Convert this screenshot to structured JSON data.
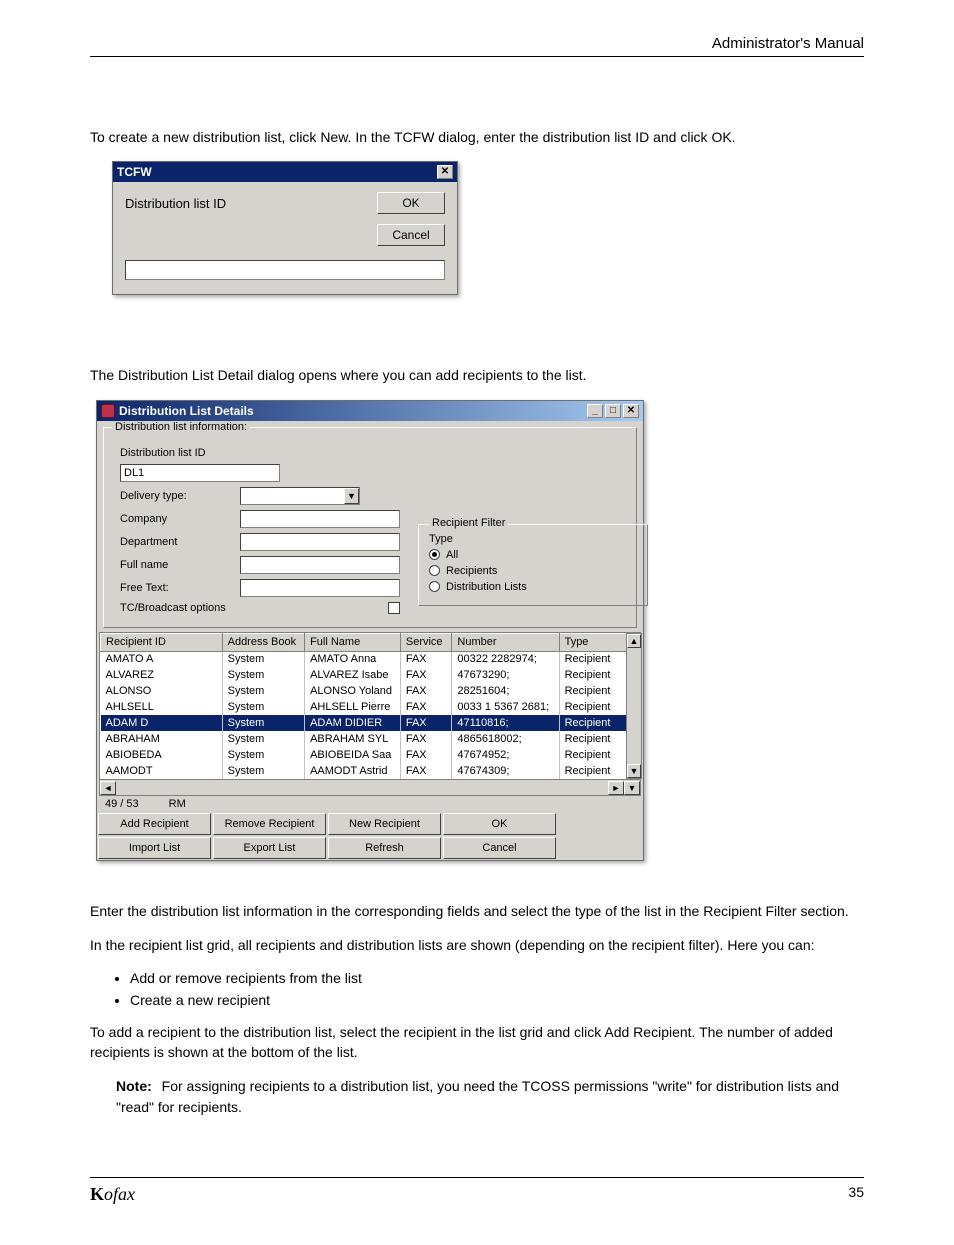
{
  "page_header": "Administrator's Manual",
  "intro_text": "To create a new distribution list, click New. In the TCFW dialog, enter the distribution list ID and click OK.",
  "tcfw": {
    "title": "TCFW",
    "label": "Distribution list ID",
    "ok": "OK",
    "cancel": "Cancel"
  },
  "mid_text": "The Distribution List Detail dialog opens where you can add recipients to the list.",
  "dld": {
    "title": "Distribution List Details",
    "group_legend": "Distribution list information:",
    "labels": {
      "id": "Distribution list ID",
      "id_value": "DL1",
      "delivery": "Delivery type:",
      "company": "Company",
      "department": "Department",
      "fullname": "Full name",
      "freetext": "Free Text:",
      "tc": "TC/Broadcast options"
    },
    "filter": {
      "legend": "Recipient Filter",
      "type_label": "Type",
      "opt_all": "All",
      "opt_recipients": "Recipients",
      "opt_distlists": "Distribution Lists"
    },
    "columns": [
      "Recipient ID",
      "Address Book",
      "Full Name",
      "Service",
      "Number",
      "Type"
    ],
    "rows": [
      {
        "id": "AMATO A",
        "book": "System",
        "name": "AMATO Anna",
        "svc": "FAX",
        "num": "00322 2282974;",
        "type": "Recipient",
        "sel": false
      },
      {
        "id": "ALVAREZ",
        "book": "System",
        "name": "ALVAREZ Isabe",
        "svc": "FAX",
        "num": "47673290;",
        "type": "Recipient",
        "sel": false
      },
      {
        "id": "ALONSO",
        "book": "System",
        "name": "ALONSO Yoland",
        "svc": "FAX",
        "num": "28251604;",
        "type": "Recipient",
        "sel": false
      },
      {
        "id": "AHLSELL",
        "book": "System",
        "name": "AHLSELL Pierre",
        "svc": "FAX",
        "num": "0033 1 5367 2681;",
        "type": "Recipient",
        "sel": false
      },
      {
        "id": "ADAM D",
        "book": "System",
        "name": "ADAM  DIDIER",
        "svc": "FAX",
        "num": "47110816;",
        "type": "Recipient",
        "sel": true
      },
      {
        "id": "ABRAHAM",
        "book": "System",
        "name": "ABRAHAM  SYL",
        "svc": "FAX",
        "num": "4865618002;",
        "type": "Recipient",
        "sel": false
      },
      {
        "id": "ABIOBEDA",
        "book": "System",
        "name": "ABIOBEIDA Saa",
        "svc": "FAX",
        "num": "47674952;",
        "type": "Recipient",
        "sel": false
      },
      {
        "id": "AAMODT",
        "book": "System",
        "name": "AAMODT Astrid",
        "svc": "FAX",
        "num": "47674309;",
        "type": "Recipient",
        "sel": false
      }
    ],
    "status_count": "49 / 53",
    "status_mode": "RM",
    "buttons": {
      "add": "Add Recipient",
      "remove": "Remove Recipient",
      "new": "New Recipient",
      "ok": "OK",
      "import": "Import List",
      "export": "Export List",
      "refresh": "Refresh",
      "cancel": "Cancel"
    }
  },
  "after_text_1": "Enter the distribution list information in the corresponding fields and select the type of the list in the Recipient Filter section.",
  "after_text_2": "In the recipient list grid, all recipients and distribution lists are shown (depending on the recipient filter). Here you can:",
  "bullets": [
    "Add or remove recipients from the list",
    "Create a new recipient"
  ],
  "after_text_3": "To add a recipient to the distribution list, select the recipient in the list grid and click Add Recipient. The number of added recipients is shown at the bottom of the list.",
  "note_label": "Note:",
  "note_text": "For assigning recipients to a distribution list, you need the TCOSS permissions \"write\" for distribution lists and \"read\" for recipients.",
  "footer_brand_prefix": "K",
  "footer_brand_rest": "ofax",
  "footer_page": "35"
}
